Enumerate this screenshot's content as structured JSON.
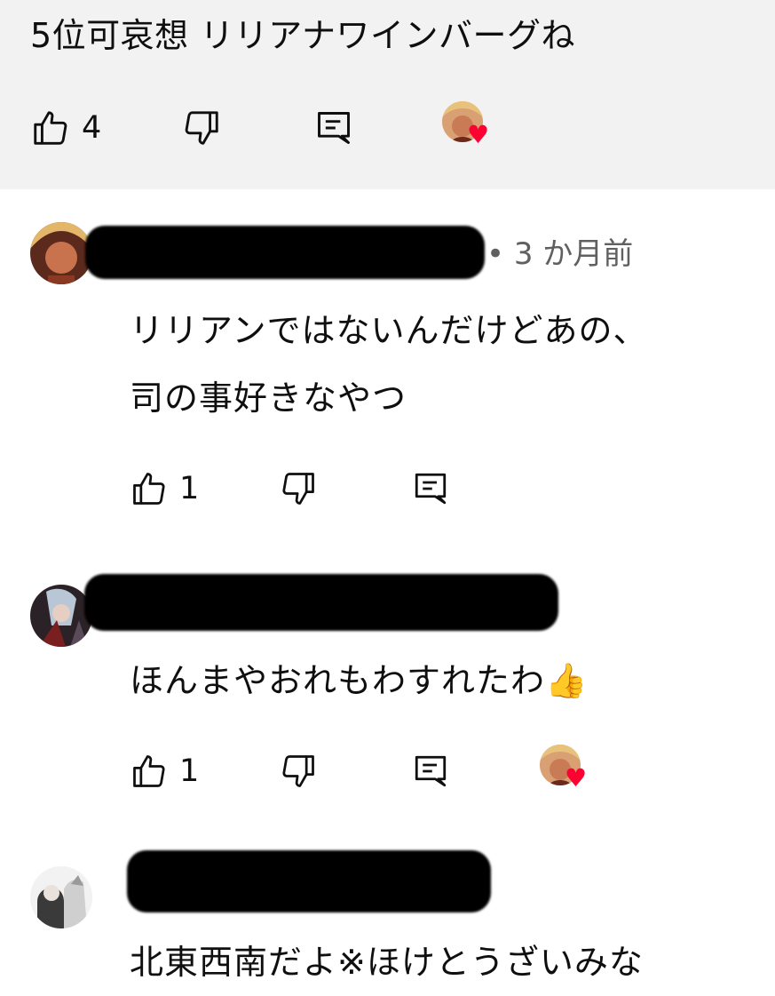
{
  "pinned": {
    "text": "5位可哀想 リリアナワインバーグね",
    "like_count": "4"
  },
  "comments": [
    {
      "meta": "• 3 か月前",
      "lines": [
        "リリアンではないんだけどあの、",
        "司の事好きなやつ"
      ],
      "like_count": "1",
      "creator_heart": false
    },
    {
      "meta": "",
      "lines": [
        "ほんまやおれもわすれたわ👍"
      ],
      "like_count": "1",
      "creator_heart": true
    },
    {
      "meta": "",
      "lines": [
        "北東西南だよ※ほけとうざいみな"
      ],
      "like_count": "",
      "creator_heart": false
    }
  ],
  "icons": {
    "like": "thumb-up-icon",
    "dislike": "thumb-down-icon",
    "reply": "reply-icon",
    "heart": "heart-icon"
  },
  "colors": {
    "pinned_bg": "#f2f2f2",
    "heart": "#ff0033",
    "meta_text": "#606060"
  }
}
